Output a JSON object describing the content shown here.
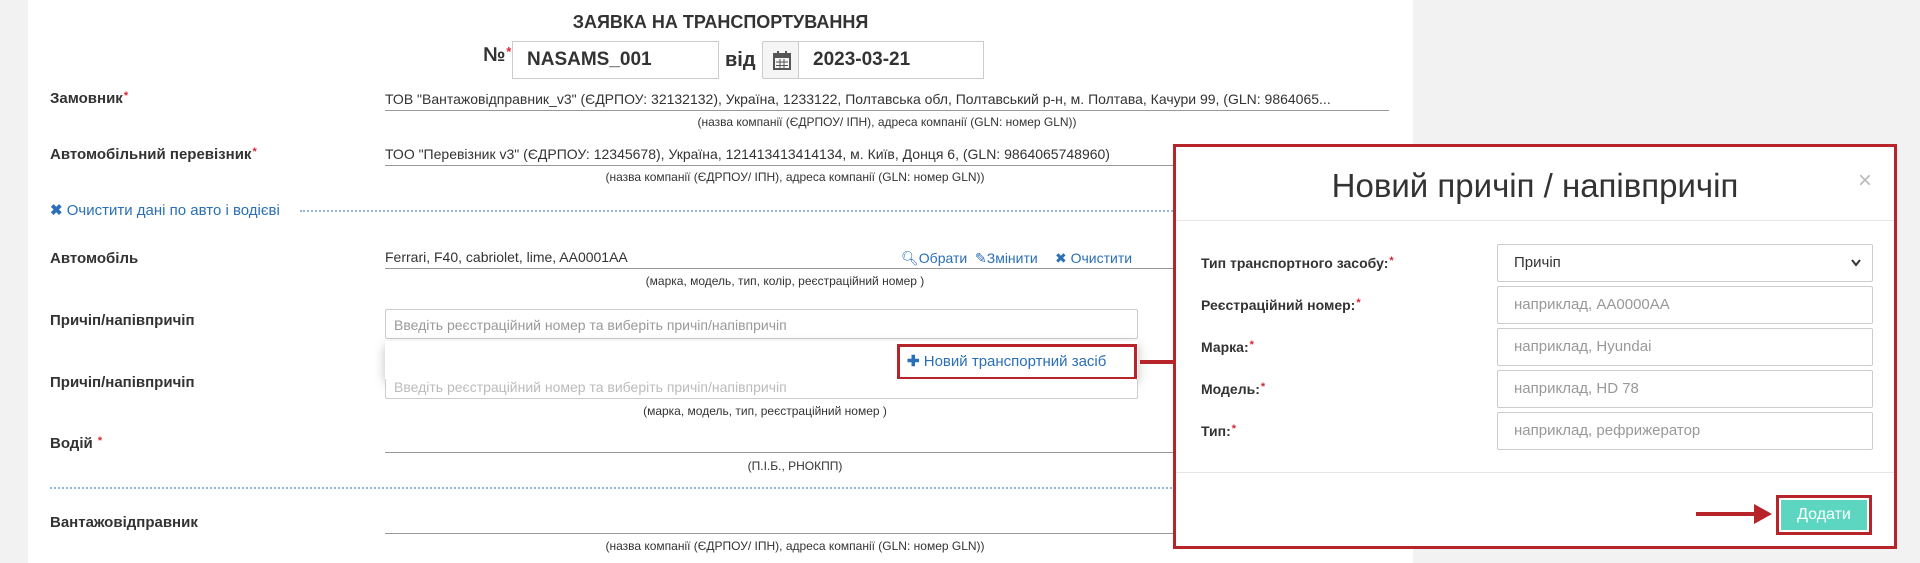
{
  "form": {
    "title": "ЗАЯВКА НА ТРАНСПОРТУВАННЯ",
    "number_label": "№",
    "required_mark": "*",
    "number_value": "NASAMS_001",
    "date_label": "від",
    "date_value": "2023-03-21"
  },
  "customer": {
    "label": "Замовник",
    "value": "ТОВ \"Вантажовідправник_v3\" (ЄДРПОУ: 32132132), Україна, 1233122, Полтавська обл, Полтавський р-н, м. Полтава, Качури 99, (GLN: 9864065...",
    "hint": "(назва компанії (ЄДРПОУ/ ІПН), адреса компанії (GLN: номер GLN))"
  },
  "carrier": {
    "label": "Автомобільний перевізник",
    "value": "ТОО \"Перевізник v3\" (ЄДРПОУ: 12345678), Україна, 121413413414134, м. Київ, Донця 6, (GLN: 9864065748960)",
    "hint": "(назва компанії (ЄДРПОУ/ ІПН), адреса компанії (GLN: номер GLN))"
  },
  "clear_link": "Очистити дані по авто і водієві",
  "vehicle": {
    "label": "Автомобіль",
    "value": "Ferrari, F40, cabriolet, lime, AA0001AA",
    "select_link": "Обрати",
    "edit_link": "Змінити",
    "clear_link": "Очистити",
    "hint": "(марка, модель, тип, колір, реєстраційний номер )"
  },
  "trailer1": {
    "label": "Причіп/напівпричіп",
    "placeholder": "Введіть реєстраційний номер та виберіть причіп/напівпричіп"
  },
  "dropdown": {
    "new_vehicle": "Новий транспортний засіб"
  },
  "trailer2": {
    "label": "Причіп/напівпричіп",
    "placeholder": "Введіть реєстраційний номер та виберіть причіп/напівпричіп",
    "hint": "(марка, модель, тип, реєстраційний номер )"
  },
  "driver": {
    "label": "Водій",
    "hint": "(П.І.Б., РНОКПП)"
  },
  "shipper": {
    "label": "Вантажовідправник",
    "hint": "(назва компанії (ЄДРПОУ/ ІПН), адреса компанії (GLN: номер GLN))"
  },
  "modal": {
    "title": "Новий причіп / напівпричіп",
    "close": "×",
    "type_label": "Тип транспортного засобу:",
    "type_value": "Причіп",
    "reg_label": "Реєстраційний номер:",
    "reg_placeholder": "наприклад, АА0000АА",
    "brand_label": "Марка:",
    "brand_placeholder": "наприклад, Hyundai",
    "model_label": "Модель:",
    "model_placeholder": "наприклад, HD 78",
    "kind_label": "Тип:",
    "kind_placeholder": "наприклад, рефрижератор",
    "add_button": "Додати"
  },
  "colors": {
    "accent_link": "#2a6fb8",
    "required": "#d9262f",
    "highlight": "#b7242a",
    "add_button": "#5cd6c0"
  }
}
